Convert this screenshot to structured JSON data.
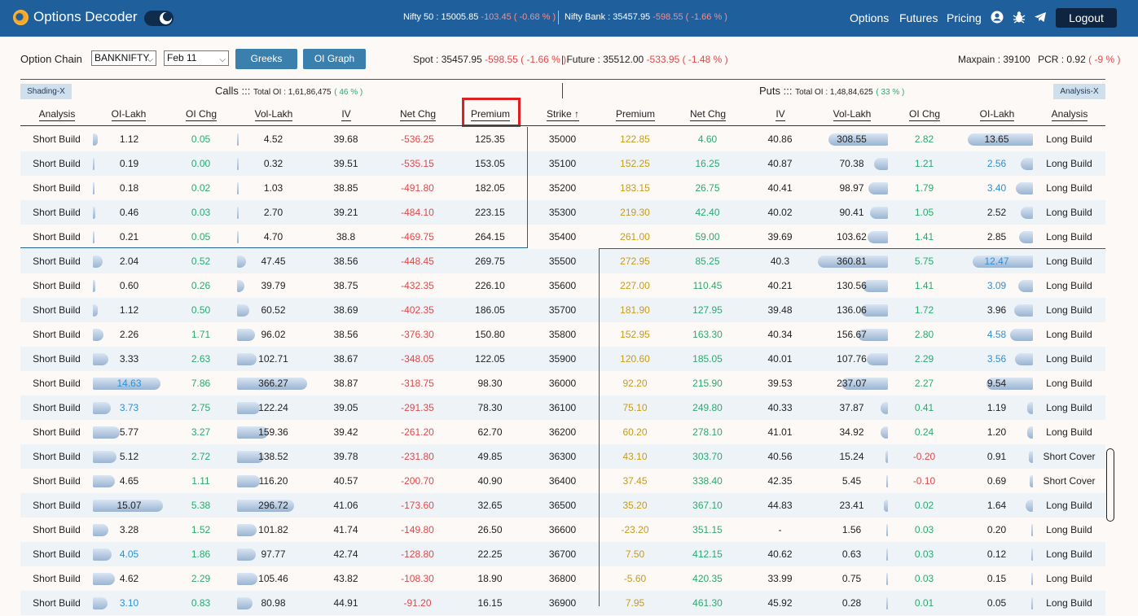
{
  "header": {
    "logo_text": "Options Decoder",
    "nifty_label": "Nifty 50 : 15005.85",
    "nifty_change": "-103.45 ( -0.68 % )",
    "banknifty_label": "Nifty Bank : 35457.95",
    "banknifty_change": "-598.55 ( -1.66 % )",
    "nav": [
      "Options",
      "Futures",
      "Pricing"
    ],
    "logout_label": "Logout"
  },
  "controls": {
    "label": "Option Chain",
    "symbol": "BANKNIFTY",
    "expiry": "Feb 11",
    "greeks_label": "Greeks",
    "oigraph_label": "OI Graph",
    "spot_label": "Spot : 35457.95",
    "spot_change": "-598.55 ( -1.66 % )",
    "future_label": "Future : 35512.00",
    "future_change": "-533.95 ( -1.48 % )",
    "maxpain": "Maxpain : 39100",
    "pcr_label": "PCR : 0.92",
    "pcr_change": "( -9 % )"
  },
  "sections": {
    "shading_label": "Shading-X",
    "analysis_label": "Analysis-X",
    "calls_title": "Calls :::",
    "calls_oi": "Total OI : 1,61,86,475",
    "calls_pct": "( 46 % )",
    "puts_title": "Puts :::",
    "puts_oi": "Total OI : 1,48,84,625",
    "puts_pct": "( 33 % )"
  },
  "columns": {
    "c_analysis": "Analysis",
    "c_oi": "OI-Lakh",
    "c_oichg": "OI Chg",
    "c_vol": "Vol-Lakh",
    "c_iv": "IV",
    "c_netchg": "Net Chg",
    "c_premium": "Premium",
    "strike": "Strike ↑",
    "p_premium": "Premium",
    "p_netchg": "Net Chg",
    "p_iv": "IV",
    "p_vol": "Vol-Lakh",
    "p_oichg": "OI Chg",
    "p_oi": "OI-Lakh",
    "p_analysis": "Analysis"
  },
  "rows": [
    {
      "ca": "Short Build",
      "coi": "1.12",
      "coif": 0.07,
      "cchg": "0.05",
      "cvol": "4.52",
      "cvolf": 0.01,
      "civ": "39.68",
      "cnet": "-536.25",
      "cprem": "125.35",
      "strike": "35000",
      "pprem": "122.85",
      "pnet": "4.60",
      "piv": "40.86",
      "pvol": "308.55",
      "pvolf": 0.85,
      "pchg": "2.82",
      "poi": "13.65",
      "poif": 0.93,
      "pa": "Long Build",
      "coi_blue": false,
      "poi_blue": false,
      "pchg_red": false
    },
    {
      "ca": "Short Build",
      "coi": "0.19",
      "coif": 0.01,
      "cchg": "0.00",
      "cvol": "0.32",
      "cvolf": 0.0,
      "civ": "39.51",
      "cnet": "-535.15",
      "cprem": "153.05",
      "strike": "35100",
      "pprem": "152.25",
      "pnet": "16.25",
      "piv": "40.87",
      "pvol": "70.38",
      "pvolf": 0.2,
      "pchg": "1.21",
      "poi": "2.56",
      "poif": 0.18,
      "pa": "Long Build",
      "coi_blue": false,
      "poi_blue": true,
      "pchg_red": false
    },
    {
      "ca": "Short Build",
      "coi": "0.18",
      "coif": 0.01,
      "cchg": "0.02",
      "cvol": "1.03",
      "cvolf": 0.0,
      "civ": "38.85",
      "cnet": "-491.80",
      "cprem": "182.05",
      "strike": "35200",
      "pprem": "183.15",
      "pnet": "26.75",
      "piv": "40.41",
      "pvol": "98.97",
      "pvolf": 0.28,
      "pchg": "1.79",
      "poi": "3.40",
      "poif": 0.24,
      "pa": "Long Build",
      "coi_blue": false,
      "poi_blue": true,
      "pchg_red": false
    },
    {
      "ca": "Short Build",
      "coi": "0.46",
      "coif": 0.03,
      "cchg": "0.03",
      "cvol": "2.70",
      "cvolf": 0.0,
      "civ": "39.21",
      "cnet": "-484.10",
      "cprem": "223.15",
      "strike": "35300",
      "pprem": "219.30",
      "pnet": "42.40",
      "piv": "40.02",
      "pvol": "90.41",
      "pvolf": 0.25,
      "pchg": "1.05",
      "poi": "2.52",
      "poif": 0.18,
      "pa": "Long Build",
      "coi_blue": false,
      "poi_blue": false,
      "pchg_red": false
    },
    {
      "ca": "Short Build",
      "coi": "0.21",
      "coif": 0.01,
      "cchg": "0.05",
      "cvol": "4.70",
      "cvolf": 0.01,
      "civ": "38.8",
      "cnet": "-469.75",
      "cprem": "264.15",
      "strike": "35400",
      "pprem": "261.00",
      "pnet": "59.00",
      "piv": "39.69",
      "pvol": "103.62",
      "pvolf": 0.29,
      "pchg": "1.41",
      "poi": "2.85",
      "poif": 0.2,
      "pa": "Long Build",
      "coi_blue": false,
      "poi_blue": false,
      "pchg_red": false
    },
    {
      "ca": "Short Build",
      "coi": "2.04",
      "coif": 0.14,
      "cchg": "0.52",
      "cvol": "47.45",
      "cvolf": 0.13,
      "civ": "38.56",
      "cnet": "-448.45",
      "cprem": "269.75",
      "strike": "35500",
      "pprem": "272.95",
      "pnet": "85.25",
      "piv": "40.3",
      "pvol": "360.81",
      "pvolf": 1.0,
      "pchg": "5.75",
      "poi": "12.47",
      "poif": 0.86,
      "pa": "Long Build",
      "coi_blue": false,
      "poi_blue": true,
      "pchg_red": false
    },
    {
      "ca": "Short Build",
      "coi": "0.60",
      "coif": 0.04,
      "cchg": "0.26",
      "cvol": "39.79",
      "cvolf": 0.11,
      "civ": "38.75",
      "cnet": "-432.35",
      "cprem": "226.10",
      "strike": "35600",
      "pprem": "227.00",
      "pnet": "110.45",
      "piv": "40.21",
      "pvol": "130.56",
      "pvolf": 0.36,
      "pchg": "1.41",
      "poi": "3.09",
      "poif": 0.21,
      "pa": "Long Build",
      "coi_blue": false,
      "poi_blue": true,
      "pchg_red": false
    },
    {
      "ca": "Short Build",
      "coi": "1.12",
      "coif": 0.07,
      "cchg": "0.50",
      "cvol": "60.52",
      "cvolf": 0.17,
      "civ": "38.69",
      "cnet": "-402.35",
      "cprem": "186.05",
      "strike": "35700",
      "pprem": "181.90",
      "pnet": "127.95",
      "piv": "39.48",
      "pvol": "136.06",
      "pvolf": 0.38,
      "pchg": "1.72",
      "poi": "3.96",
      "poif": 0.27,
      "pa": "Long Build",
      "coi_blue": false,
      "poi_blue": false,
      "pchg_red": false
    },
    {
      "ca": "Short Build",
      "coi": "2.26",
      "coif": 0.15,
      "cchg": "1.71",
      "cvol": "96.02",
      "cvolf": 0.26,
      "civ": "38.56",
      "cnet": "-376.30",
      "cprem": "150.80",
      "strike": "35800",
      "pprem": "152.95",
      "pnet": "163.30",
      "piv": "40.34",
      "pvol": "156.67",
      "pvolf": 0.43,
      "pchg": "2.80",
      "poi": "4.58",
      "poif": 0.32,
      "pa": "Long Build",
      "coi_blue": false,
      "poi_blue": true,
      "pchg_red": false
    },
    {
      "ca": "Short Build",
      "coi": "3.33",
      "coif": 0.22,
      "cchg": "2.63",
      "cvol": "102.71",
      "cvolf": 0.28,
      "civ": "38.67",
      "cnet": "-348.05",
      "cprem": "122.05",
      "strike": "35900",
      "pprem": "120.60",
      "pnet": "185.05",
      "piv": "40.01",
      "pvol": "107.76",
      "pvolf": 0.3,
      "pchg": "2.29",
      "poi": "3.56",
      "poif": 0.25,
      "pa": "Long Build",
      "coi_blue": false,
      "poi_blue": true,
      "pchg_red": false
    },
    {
      "ca": "Short Build",
      "coi": "14.63",
      "coif": 0.97,
      "cchg": "7.86",
      "cvol": "366.27",
      "cvolf": 1.0,
      "civ": "38.87",
      "cnet": "-318.75",
      "cprem": "98.30",
      "strike": "36000",
      "pprem": "92.20",
      "pnet": "215.90",
      "piv": "39.53",
      "pvol": "237.07",
      "pvolf": 0.66,
      "pchg": "2.27",
      "poi": "9.54",
      "poif": 0.66,
      "pa": "Long Build",
      "coi_blue": true,
      "poi_blue": false,
      "pchg_red": false
    },
    {
      "ca": "Short Build",
      "coi": "3.73",
      "coif": 0.25,
      "cchg": "2.75",
      "cvol": "122.24",
      "cvolf": 0.33,
      "civ": "39.05",
      "cnet": "-291.35",
      "cprem": "78.30",
      "strike": "36100",
      "pprem": "75.10",
      "pnet": "249.80",
      "piv": "40.33",
      "pvol": "37.87",
      "pvolf": 0.1,
      "pchg": "0.41",
      "poi": "1.19",
      "poif": 0.08,
      "pa": "Long Build",
      "coi_blue": true,
      "poi_blue": false,
      "pchg_red": false
    },
    {
      "ca": "Short Build",
      "coi": "5.77",
      "coif": 0.38,
      "cchg": "3.27",
      "cvol": "159.36",
      "cvolf": 0.44,
      "civ": "39.42",
      "cnet": "-261.20",
      "cprem": "62.70",
      "strike": "36200",
      "pprem": "60.20",
      "pnet": "278.10",
      "piv": "41.01",
      "pvol": "34.92",
      "pvolf": 0.1,
      "pchg": "0.24",
      "poi": "1.20",
      "poif": 0.08,
      "pa": "Long Build",
      "coi_blue": false,
      "poi_blue": false,
      "pchg_red": false
    },
    {
      "ca": "Short Build",
      "coi": "5.12",
      "coif": 0.34,
      "cchg": "2.72",
      "cvol": "138.52",
      "cvolf": 0.38,
      "civ": "39.78",
      "cnet": "-231.80",
      "cprem": "49.85",
      "strike": "36300",
      "pprem": "43.10",
      "pnet": "303.70",
      "piv": "40.56",
      "pvol": "15.24",
      "pvolf": 0.04,
      "pchg": "-0.20",
      "poi": "0.91",
      "poif": 0.06,
      "pa": "Short Cover",
      "coi_blue": false,
      "poi_blue": false,
      "pchg_red": true
    },
    {
      "ca": "Short Build",
      "coi": "4.65",
      "coif": 0.31,
      "cchg": "1.11",
      "cvol": "116.20",
      "cvolf": 0.32,
      "civ": "40.57",
      "cnet": "-200.70",
      "cprem": "40.90",
      "strike": "36400",
      "pprem": "37.45",
      "pnet": "338.40",
      "piv": "42.35",
      "pvol": "5.45",
      "pvolf": 0.02,
      "pchg": "-0.10",
      "poi": "0.69",
      "poif": 0.05,
      "pa": "Short Cover",
      "coi_blue": false,
      "poi_blue": false,
      "pchg_red": true
    },
    {
      "ca": "Short Build",
      "coi": "15.07",
      "coif": 1.0,
      "cchg": "5.38",
      "cvol": "296.72",
      "cvolf": 0.81,
      "civ": "41.06",
      "cnet": "-173.60",
      "cprem": "32.65",
      "strike": "36500",
      "pprem": "35.20",
      "pnet": "367.10",
      "piv": "44.83",
      "pvol": "23.41",
      "pvolf": 0.06,
      "pchg": "0.02",
      "poi": "1.64",
      "poif": 0.11,
      "pa": "Long Build",
      "coi_blue": false,
      "poi_blue": false,
      "pchg_red": false
    },
    {
      "ca": "Short Build",
      "coi": "3.28",
      "coif": 0.22,
      "cchg": "1.52",
      "cvol": "101.82",
      "cvolf": 0.28,
      "civ": "41.74",
      "cnet": "-149.80",
      "cprem": "26.50",
      "strike": "36600",
      "pprem": "-23.20",
      "pnet": "351.15",
      "piv": "-",
      "pvol": "1.56",
      "pvolf": 0.0,
      "pchg": "0.03",
      "poi": "0.20",
      "poif": 0.01,
      "pa": "Long Build",
      "coi_blue": false,
      "poi_blue": false,
      "pchg_red": false
    },
    {
      "ca": "Short Build",
      "coi": "4.05",
      "coif": 0.27,
      "cchg": "1.86",
      "cvol": "97.77",
      "cvolf": 0.27,
      "civ": "42.74",
      "cnet": "-128.80",
      "cprem": "22.25",
      "strike": "36700",
      "pprem": "7.50",
      "pnet": "412.15",
      "piv": "40.62",
      "pvol": "0.63",
      "pvolf": 0.0,
      "pchg": "0.03",
      "poi": "0.12",
      "poif": 0.01,
      "pa": "Long Build",
      "coi_blue": true,
      "poi_blue": false,
      "pchg_red": false
    },
    {
      "ca": "Short Build",
      "coi": "4.62",
      "coif": 0.31,
      "cchg": "2.29",
      "cvol": "105.46",
      "cvolf": 0.29,
      "civ": "43.82",
      "cnet": "-108.30",
      "cprem": "18.90",
      "strike": "36800",
      "pprem": "-5.60",
      "pnet": "420.35",
      "piv": "33.99",
      "pvol": "0.75",
      "pvolf": 0.0,
      "pchg": "0.03",
      "poi": "0.15",
      "poif": 0.01,
      "pa": "Long Build",
      "coi_blue": false,
      "poi_blue": false,
      "pchg_red": false
    },
    {
      "ca": "Short Build",
      "coi": "3.10",
      "coif": 0.21,
      "cchg": "0.83",
      "cvol": "80.98",
      "cvolf": 0.22,
      "civ": "44.91",
      "cnet": "-91.20",
      "cprem": "16.15",
      "strike": "36900",
      "pprem": "7.95",
      "pnet": "461.30",
      "piv": "45.92",
      "pvol": "0.28",
      "pvolf": 0.0,
      "pchg": "0.01",
      "poi": "0.05",
      "poif": 0.0,
      "pa": "Long Build",
      "coi_blue": true,
      "poi_blue": false,
      "pchg_red": false
    }
  ]
}
